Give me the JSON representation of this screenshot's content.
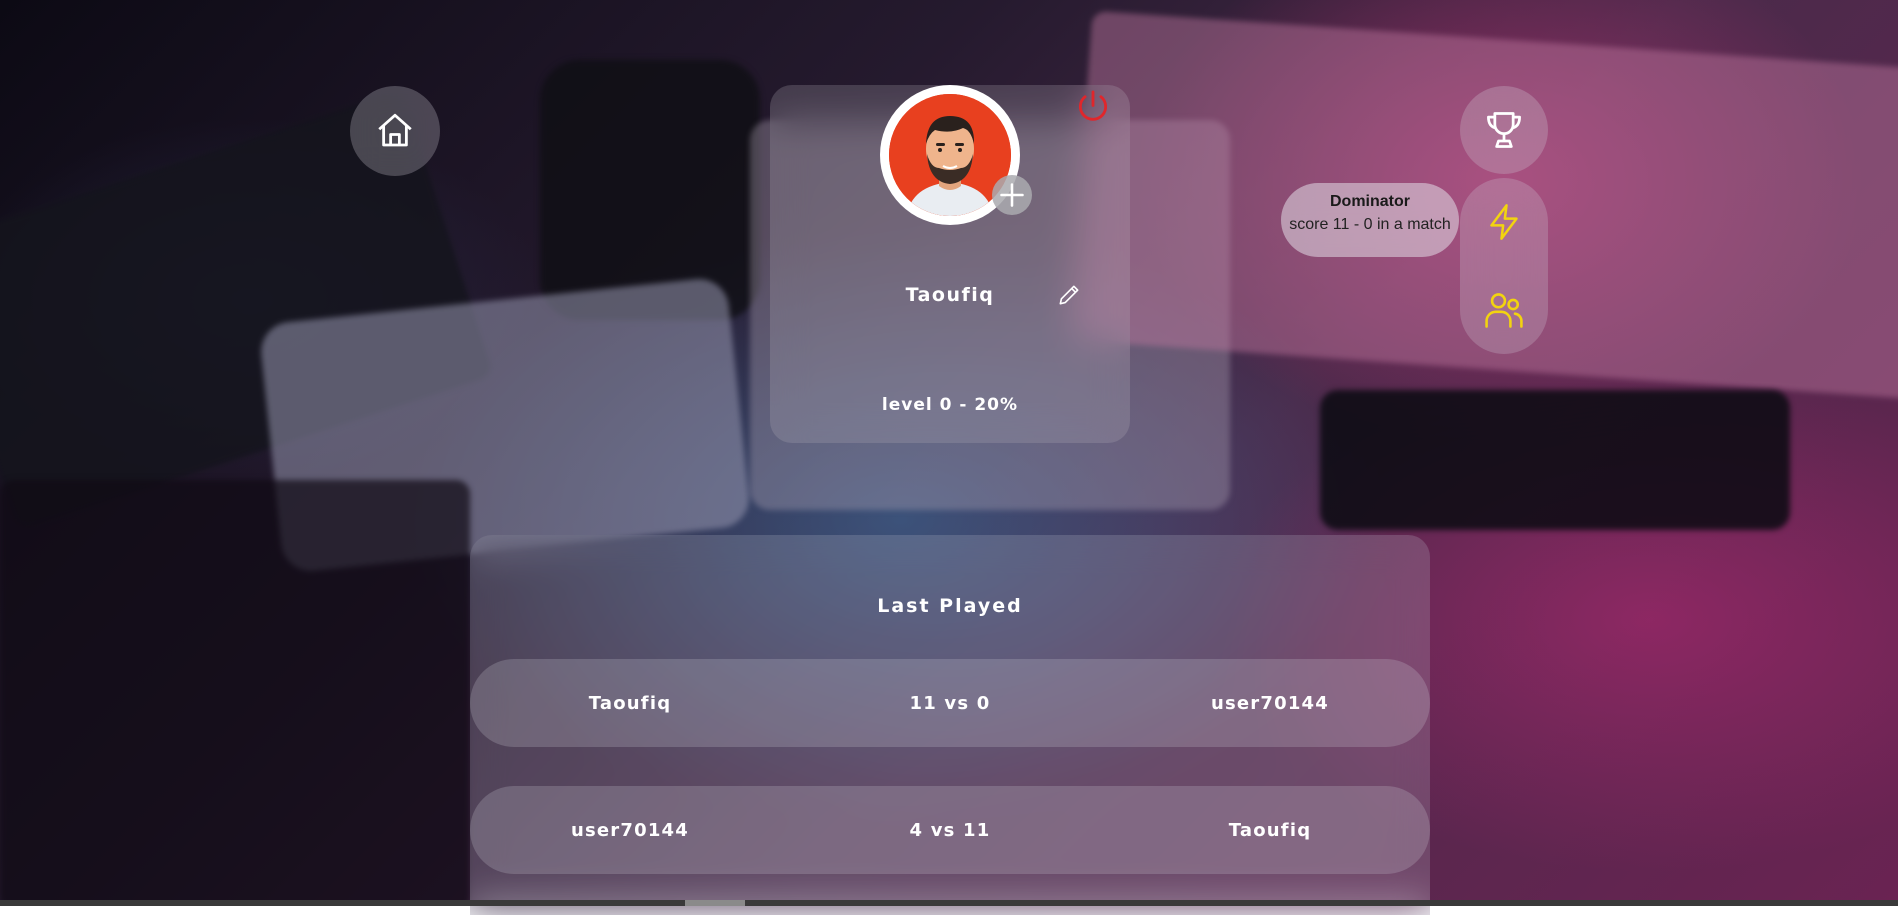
{
  "nav": {
    "home_icon": "home-icon",
    "trophy_icon": "trophy-icon",
    "lightning_icon": "lightning-icon",
    "friends_icon": "users-icon"
  },
  "profile": {
    "username": "Taoufiq",
    "level": "level 0 - 20%",
    "avatar_icon": "avatar-icon",
    "add_avatar_icon": "plus-icon",
    "power_icon": "power-icon",
    "edit_icon": "pencil-icon"
  },
  "achievement": {
    "title": "Dominator",
    "description": "score 11 - 0 in a match"
  },
  "history": {
    "title": "Last Played",
    "matches": [
      {
        "player1": "Taoufiq",
        "score": "11 vs 0",
        "player2": "user70144"
      },
      {
        "player1": "user70144",
        "score": "4 vs 11",
        "player2": "Taoufiq"
      }
    ]
  },
  "colors": {
    "accent_yellow": "#f2d40f",
    "power_red": "#e0262b",
    "avatar_bg": "#e8401f"
  }
}
